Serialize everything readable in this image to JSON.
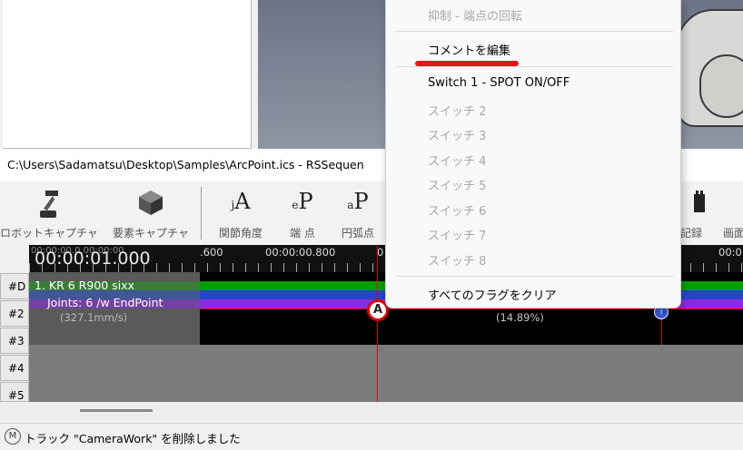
{
  "window": {
    "title": "C:\\Users\\Sadamatsu\\Desktop\\Samples\\ArcPoint.ics - RSSequen"
  },
  "toolbar": {
    "buttons": [
      {
        "icon": "robot-capture-icon",
        "label": "ロボットキャプチャ"
      },
      {
        "icon": "element-capture-icon",
        "label": "要素キャプチャ"
      },
      {
        "icon": "joint-angle-icon",
        "glyph": "jA",
        "label": "関節角度"
      },
      {
        "icon": "endpoint-icon",
        "glyph": "eP",
        "label": "端 点"
      },
      {
        "icon": "arc-point-icon",
        "glyph": "aP",
        "label": "円弧点"
      },
      {
        "icon": "record-icon",
        "label": "記録"
      },
      {
        "icon": "screen-icon",
        "label": "画面"
      }
    ]
  },
  "timeline": {
    "current_time": "00:00:01.000",
    "ghost_time": "00:00:00.0.00:00:00.",
    "ruler_labels": [
      ".600",
      "00:00:00.800",
      "0",
      "00:0"
    ],
    "track_headers": [
      "#D",
      "#2",
      "#3",
      "#4",
      "#5"
    ],
    "track": {
      "name": "1.  KR 6 R900 sixx",
      "joints": "Joints: 6 /w EndPoint",
      "speed": "(327.1mm/s)",
      "percent": "(14.89%)",
      "playhead_marker": "A",
      "endpoint_marker": "i"
    }
  },
  "context_menu": {
    "items": [
      {
        "label": "抑制 - 端点の回転",
        "enabled": false
      },
      {
        "label": "コメントを編集",
        "enabled": true
      },
      {
        "label": "Switch 1 - SPOT ON/OFF",
        "enabled": true
      },
      {
        "label": "スイッチ 2",
        "enabled": false
      },
      {
        "label": "スイッチ 3",
        "enabled": false
      },
      {
        "label": "スイッチ 4",
        "enabled": false
      },
      {
        "label": "スイッチ 5",
        "enabled": false
      },
      {
        "label": "スイッチ 6",
        "enabled": false
      },
      {
        "label": "スイッチ 7",
        "enabled": false
      },
      {
        "label": "スイッチ 8",
        "enabled": false
      },
      {
        "label": "すべてのフラグをクリア",
        "enabled": true
      }
    ]
  },
  "status": {
    "icon_letter": "M",
    "text": "トラック \"CameraWork\" を削除しました"
  },
  "colors": {
    "highlight_underline": "#e8141c",
    "playhead": "#e00000"
  }
}
